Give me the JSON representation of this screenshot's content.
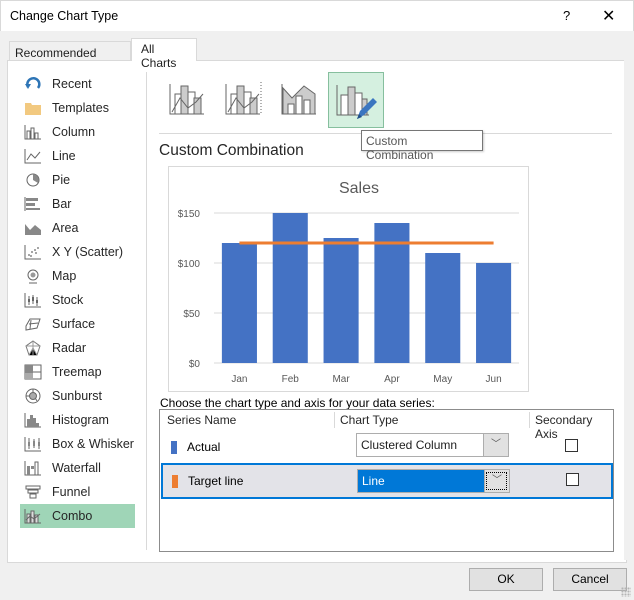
{
  "window": {
    "title": "Change Chart Type",
    "help_label": "?",
    "close_label": "✕"
  },
  "tabs": [
    {
      "label": "Recommended Charts",
      "active": false
    },
    {
      "label": "All Charts",
      "active": true
    }
  ],
  "sidebar": {
    "items": [
      {
        "label": "Recent",
        "icon": "recent-icon"
      },
      {
        "label": "Templates",
        "icon": "templates-folder-icon"
      },
      {
        "label": "Column",
        "icon": "column-chart-icon"
      },
      {
        "label": "Line",
        "icon": "line-chart-icon"
      },
      {
        "label": "Pie",
        "icon": "pie-chart-icon"
      },
      {
        "label": "Bar",
        "icon": "bar-chart-icon"
      },
      {
        "label": "Area",
        "icon": "area-chart-icon"
      },
      {
        "label": "X Y (Scatter)",
        "icon": "scatter-chart-icon"
      },
      {
        "label": "Map",
        "icon": "map-chart-icon"
      },
      {
        "label": "Stock",
        "icon": "stock-chart-icon"
      },
      {
        "label": "Surface",
        "icon": "surface-chart-icon"
      },
      {
        "label": "Radar",
        "icon": "radar-chart-icon"
      },
      {
        "label": "Treemap",
        "icon": "treemap-chart-icon"
      },
      {
        "label": "Sunburst",
        "icon": "sunburst-chart-icon"
      },
      {
        "label": "Histogram",
        "icon": "histogram-chart-icon"
      },
      {
        "label": "Box & Whisker",
        "icon": "box-whisker-chart-icon"
      },
      {
        "label": "Waterfall",
        "icon": "waterfall-chart-icon"
      },
      {
        "label": "Funnel",
        "icon": "funnel-chart-icon"
      },
      {
        "label": "Combo",
        "icon": "combo-chart-icon",
        "selected": true
      }
    ]
  },
  "subtypes": [
    {
      "name": "clustered-column-line",
      "selected": false
    },
    {
      "name": "clustered-column-line-secondary-axis",
      "selected": false
    },
    {
      "name": "stacked-area-clustered-column",
      "selected": false
    },
    {
      "name": "custom-combination",
      "selected": true
    }
  ],
  "tooltip": "Custom Combination",
  "section_title": "Custom Combination",
  "colors": {
    "column": "#4472c4",
    "line": "#ed7d31",
    "selected_green": "#9fd5b7",
    "accent_blue": "#0078d7"
  },
  "chart_data": {
    "type": "bar",
    "title": "Sales",
    "categories": [
      "Jan",
      "Feb",
      "Mar",
      "Apr",
      "May",
      "Jun"
    ],
    "series": [
      {
        "name": "Actual",
        "type": "column",
        "values": [
          120,
          150,
          125,
          140,
          110,
          100
        ]
      },
      {
        "name": "Target line",
        "type": "line",
        "values": [
          120,
          120,
          120,
          120,
          120,
          120
        ]
      }
    ],
    "yticks": [
      "$0",
      "$50",
      "$100",
      "$150"
    ],
    "ylim": [
      0,
      150
    ],
    "xlabel": "",
    "ylabel": "",
    "grid": true,
    "legend": "none"
  },
  "series_table": {
    "instruction": "Choose the chart type and axis for your data series:",
    "headers": {
      "series_name": "Series Name",
      "chart_type": "Chart Type",
      "secondary_axis": "Secondary Axis"
    },
    "rows": [
      {
        "name": "Actual",
        "chart_type": "Clustered Column",
        "secondary_axis": false,
        "selected": false
      },
      {
        "name": "Target line",
        "chart_type": "Line",
        "secondary_axis": false,
        "selected": true
      }
    ]
  },
  "footer": {
    "ok_label": "OK",
    "cancel_label": "Cancel"
  }
}
